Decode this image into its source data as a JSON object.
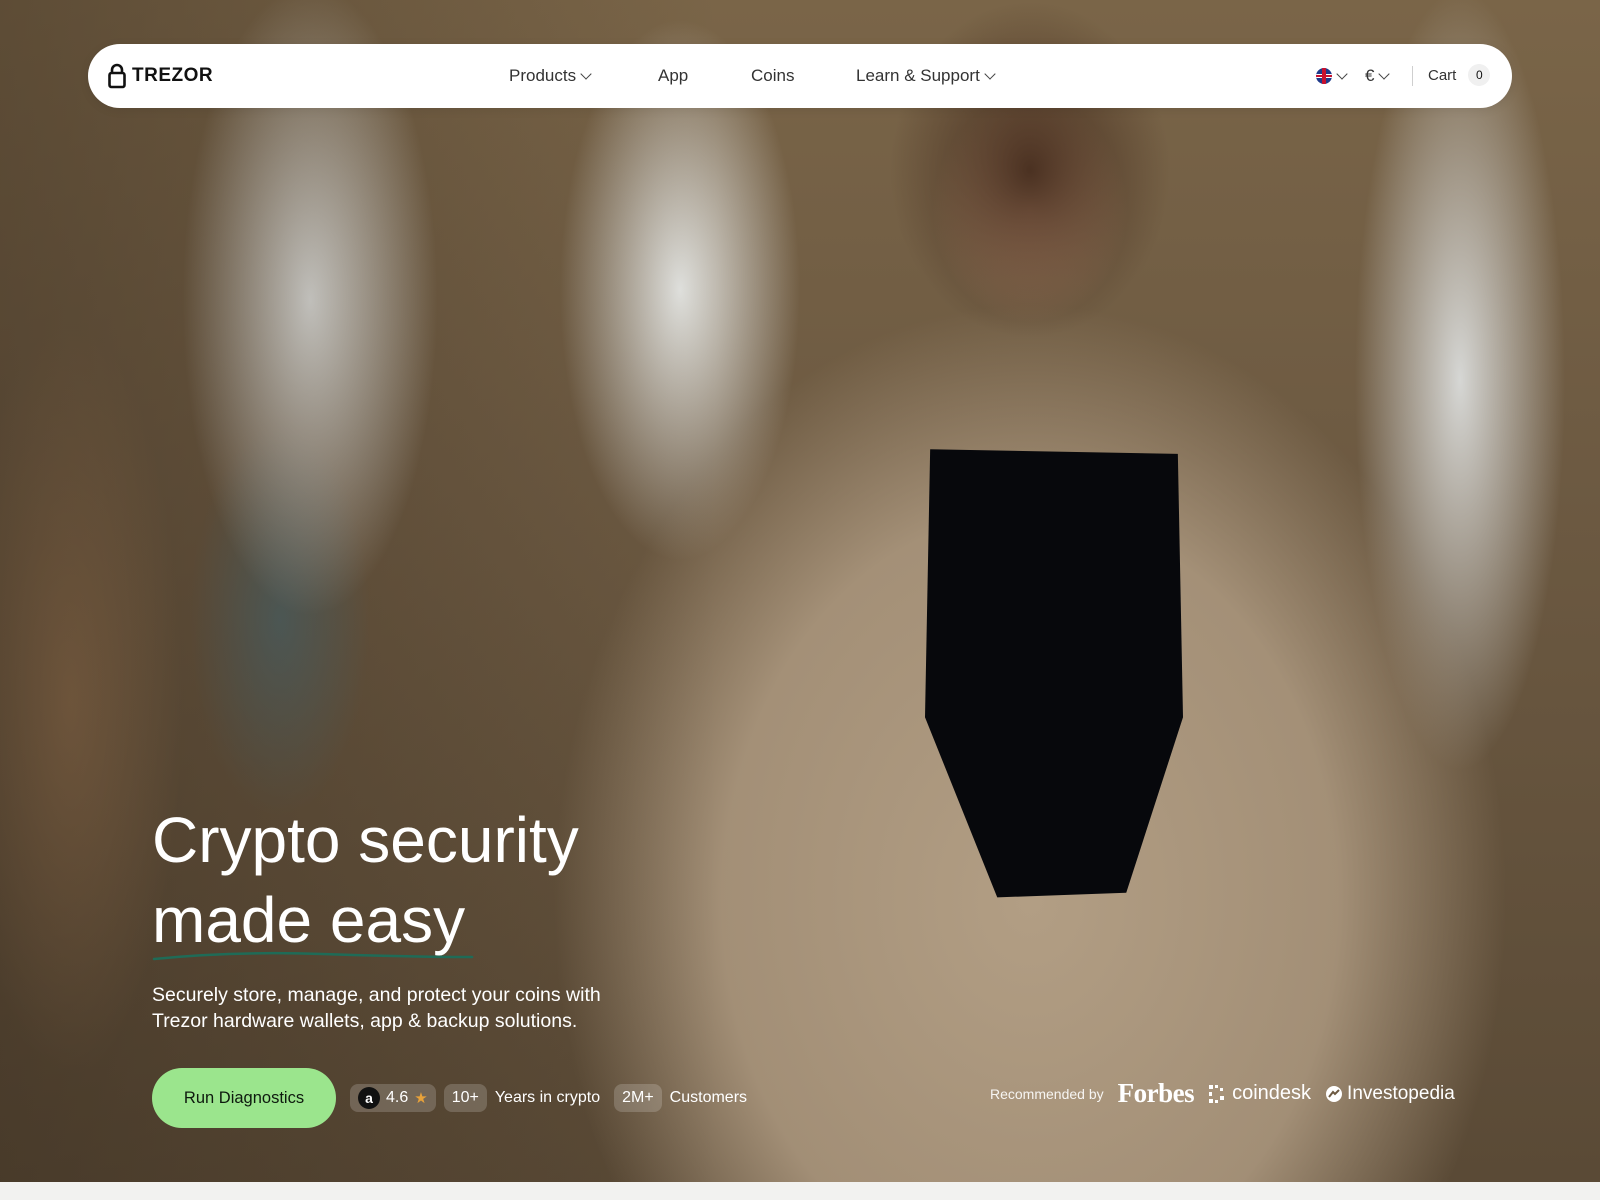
{
  "header": {
    "brand": "TREZOR",
    "nav": [
      {
        "label": "Products",
        "has_dropdown": true
      },
      {
        "label": "App",
        "has_dropdown": false
      },
      {
        "label": "Coins",
        "has_dropdown": false
      },
      {
        "label": "Learn & Support",
        "has_dropdown": true
      }
    ],
    "language_icon": "uk-flag-icon",
    "currency": "€",
    "cart_label": "Cart",
    "cart_count": "0"
  },
  "hero": {
    "headline_line1": "Crypto security",
    "headline_line2": "made easy",
    "subtitle_line1": "Securely store, manage, and protect your coins with",
    "subtitle_line2": "Trezor hardware wallets, app & backup solutions.",
    "cta_label": "Run Diagnostics",
    "rating_icon": "amazon-icon",
    "rating": "4.6",
    "years_value": "10+",
    "years_label": "Years in crypto",
    "customers_value": "2M+",
    "customers_label": "Customers"
  },
  "recommended": {
    "label": "Recommended by",
    "brands": [
      "Forbes",
      "coindesk",
      "Investopedia"
    ]
  },
  "colors": {
    "cta_bg": "#9be58d",
    "underline": "#1f6b57",
    "nav_bg": "#ffffff"
  }
}
